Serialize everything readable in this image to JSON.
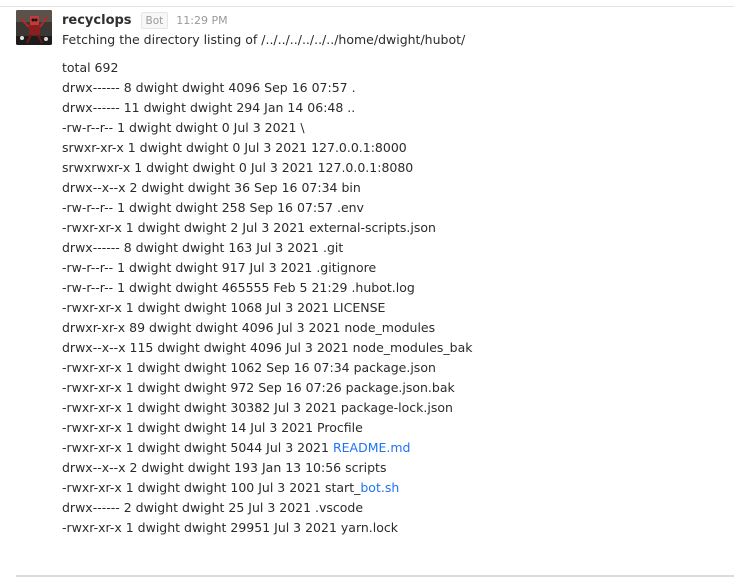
{
  "message": {
    "username": "recyclops",
    "badge": "Bot",
    "time": "11:29 PM",
    "fetch_text": "Fetching the directory listing of /../../../../../../home/dwight/hubot/",
    "lines": [
      {
        "text": "total 692"
      },
      {
        "text": "drwx------ 8 dwight dwight 4096 Sep 16 07:57 ."
      },
      {
        "text": "drwx------ 11 dwight dwight 294 Jan 14 06:48 .."
      },
      {
        "text": "-rw-r--r-- 1 dwight dwight 0 Jul 3 2021 \\"
      },
      {
        "text": "srwxr-xr-x 1 dwight dwight 0 Jul 3 2021 127.0.0.1:8000"
      },
      {
        "text": "srwxrwxr-x 1 dwight dwight 0 Jul 3 2021 127.0.0.1:8080"
      },
      {
        "text": "drwx--x--x 2 dwight dwight 36 Sep 16 07:34 bin"
      },
      {
        "text": "-rw-r--r-- 1 dwight dwight 258 Sep 16 07:57 .env"
      },
      {
        "text": "-rwxr-xr-x 1 dwight dwight 2 Jul 3 2021 external-scripts.json"
      },
      {
        "text": "drwx------ 8 dwight dwight 163 Jul 3 2021 .git"
      },
      {
        "text": "-rw-r--r-- 1 dwight dwight 917 Jul 3 2021 .gitignore"
      },
      {
        "text": "-rw-r--r-- 1 dwight dwight 465555 Feb 5 21:29 .hubot.log"
      },
      {
        "text": "-rwxr-xr-x 1 dwight dwight 1068 Jul 3 2021 LICENSE"
      },
      {
        "text": "drwxr-xr-x 89 dwight dwight 4096 Jul 3 2021 node_modules"
      },
      {
        "text": "drwx--x--x 115 dwight dwight 4096 Jul 3 2021 node_modules_bak"
      },
      {
        "text": "-rwxr-xr-x 1 dwight dwight 1062 Sep 16 07:34 package.json"
      },
      {
        "text": "-rwxr-xr-x 1 dwight dwight 972 Sep 16 07:26 package.json.bak"
      },
      {
        "text": "-rwxr-xr-x 1 dwight dwight 30382 Jul 3 2021 package-lock.json"
      },
      {
        "text": "-rwxr-xr-x 1 dwight dwight 14 Jul 3 2021 Procfile"
      },
      {
        "text": "-rwxr-xr-x 1 dwight dwight 5044 Jul 3 2021 ",
        "link": "README.md"
      },
      {
        "text": "drwx--x--x 2 dwight dwight 193 Jan 13 10:56 scripts"
      },
      {
        "text": "-rwxr-xr-x 1 dwight dwight 100 Jul 3 2021 start_",
        "link": "bot.sh"
      },
      {
        "text": "drwx------ 2 dwight dwight 25 Jul 3 2021 .vscode"
      },
      {
        "text": "-rwxr-xr-x 1 dwight dwight 29951 Jul 3 2021 yarn.lock"
      }
    ]
  },
  "colors": {
    "link": "#1d74f5",
    "text": "#2b2b2b",
    "muted": "#9a9a9a"
  },
  "icons": {
    "avatar": "robot-avatar-image"
  }
}
